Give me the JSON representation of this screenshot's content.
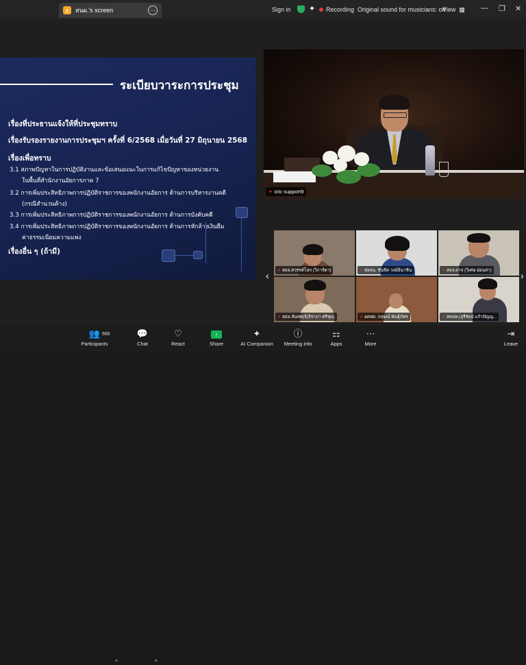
{
  "window": {
    "tab_title": "สนผ.'s screen",
    "sign_in": "Sign in",
    "recording": "Recording",
    "original_sound": "Original sound for musicians: off",
    "view": "View"
  },
  "slide": {
    "title": "ระเบียบวาระการประชุม",
    "lines": [
      "เรื่องที่ประธานแจ้งให้ที่ประชุมทราบ",
      "เรื่องรับรองรายงานการประชุมฯ ครั้งที่ 6/2568 เมื่อวันที่ 27 มิถุนายน 2568",
      "เรื่องเพื่อทราบ",
      "3.1 สภาพปัญหาในการปฏิบัติงานและข้อเสนอแนะในการแก้ไขปัญหาของหน่วยงาน",
      "ในพื้นที่สำนักงานอัยการภาค 7",
      "3.2 การเพิ่มประสิทธิภาพการปฏิบัติราชการของพนักงานอัยการ ด้านการบริหารงานคดี",
      "(กรณีสำนวนค้าง)",
      "3.3 การเพิ่มประสิทธิภาพการปฏิบัติราชการของพนักงานอัยการ ด้านการบังคับคดี",
      "3.4 การเพิ่มประสิทธิภาพการปฏิบัติราชการของพนักงานอัยการ ด้านการหักล้างเงินยืม",
      "ค่าธรรมเนียมความแพ่ง",
      "เรื่องอื่น ๆ (ถ้ามี)"
    ]
  },
  "speaker": {
    "name": "ictc support9"
  },
  "participants": [
    "สอจ.สวรรค์โลก (วิการ์ดา)",
    "สอจน. ขันจีต วงษ์อินาชิน",
    "สอจ.ผ่าจ (วิเศษ อ่อนสา)",
    "สอจ.ลั่นทท(จิ(จิราภา ศรีชุม)",
    "อดสด. กฤษณ์ พันธ์ุภัทร",
    "สคปท.(จุรีรัตน์ แก้วปัญญ..."
  ],
  "toolbar": {
    "participants_count": "666",
    "participants": "Participants",
    "chat": "Chat",
    "react": "React",
    "share": "Share",
    "ai_companion": "AI Companion",
    "meeting_info": "Meeting info",
    "apps": "Apps",
    "more": "More",
    "leave": "Leave"
  },
  "colors": {
    "share": "#16b35a",
    "recording_dot": "#e53935",
    "slide_bg": "#1c2a5e"
  }
}
